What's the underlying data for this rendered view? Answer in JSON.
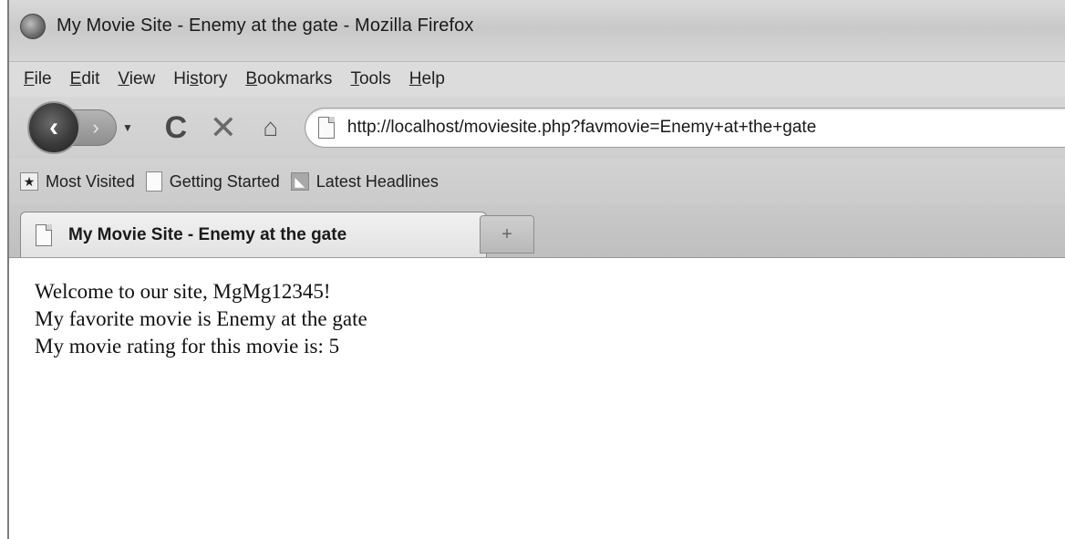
{
  "window": {
    "title": "My Movie Site - Enemy at the gate - Mozilla Firefox"
  },
  "menu": {
    "items": [
      {
        "pre": "",
        "u": "F",
        "post": "ile"
      },
      {
        "pre": "",
        "u": "E",
        "post": "dit"
      },
      {
        "pre": "",
        "u": "V",
        "post": "iew"
      },
      {
        "pre": "Hi",
        "u": "s",
        "post": "tory"
      },
      {
        "pre": "",
        "u": "B",
        "post": "ookmarks"
      },
      {
        "pre": "",
        "u": "T",
        "post": "ools"
      },
      {
        "pre": "",
        "u": "H",
        "post": "elp"
      }
    ]
  },
  "nav": {
    "url": "http://localhost/moviesite.php?favmovie=Enemy+at+the+gate",
    "icons": [
      "back-icon",
      "forward-icon",
      "reload-icon",
      "stop-icon",
      "home-icon",
      "page-icon"
    ]
  },
  "bookmarks": [
    {
      "label": "Most Visited",
      "icon": "most-visited-icon"
    },
    {
      "label": "Getting Started",
      "icon": "page-icon"
    },
    {
      "label": "Latest Headlines",
      "icon": "rss-icon"
    }
  ],
  "tabs": [
    {
      "label": "My Movie Site - Enemy at the gate",
      "active": true
    }
  ],
  "content": {
    "lines": [
      "Welcome to our site, MgMg12345!",
      "My favorite movie is Enemy at the gate",
      "My movie rating for this movie is: 5"
    ]
  }
}
